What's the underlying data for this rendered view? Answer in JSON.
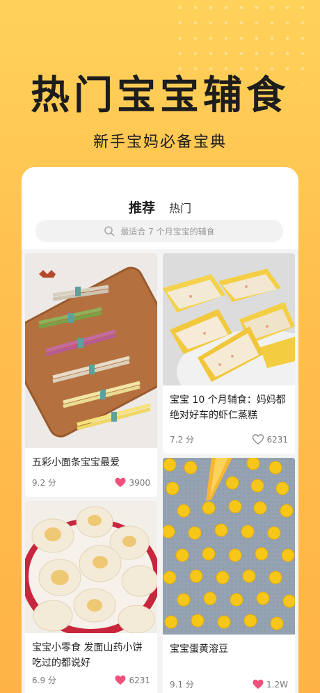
{
  "hero": {
    "title": "热门宝宝辅食",
    "subtitle": "新手宝妈必备宝典"
  },
  "tabs": [
    {
      "label": "推荐",
      "active": true
    },
    {
      "label": "热门",
      "active": false
    }
  ],
  "search": {
    "placeholder": "最适合 7 个月宝宝的辅食",
    "icon": "search-icon"
  },
  "recipes": [
    {
      "title": "五彩小面条宝宝最爱",
      "score": "9.2 分",
      "likes": "3900",
      "liked": true
    },
    {
      "title": "宝宝 10 个月辅食：妈妈都绝对好车的虾仁蒸糕",
      "score": "7.2 分",
      "likes": "6231",
      "liked": false
    },
    {
      "title": "宝宝小零食 发面山药小饼吃过的都说好",
      "score": "6.9 分",
      "likes": "6231",
      "liked": true
    },
    {
      "title": "宝宝蛋黄溶豆",
      "score": "9.1 分",
      "likes": "1.2W",
      "liked": true
    }
  ],
  "colors": {
    "accent": "#ffc93c",
    "like_active": "#f0507a",
    "like_inactive": "#888888"
  }
}
